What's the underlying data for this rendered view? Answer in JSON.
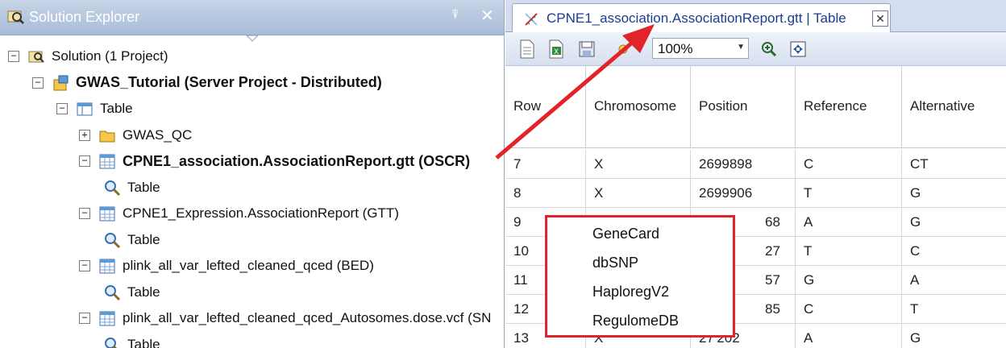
{
  "solution_explorer": {
    "title": "Solution Explorer",
    "pin_glyph": "⍒",
    "close_glyph": "✕",
    "tree": [
      {
        "label": "Solution (1 Project)",
        "expander": "−",
        "icon": "solution-icon",
        "bold": false
      },
      {
        "label": "GWAS_Tutorial (Server Project - Distributed)",
        "expander": "−",
        "icon": "project-icon",
        "bold": true
      },
      {
        "label": "Table",
        "expander": "−",
        "icon": "table-folder-icon",
        "bold": false
      },
      {
        "label": "GWAS_QC",
        "expander": "+",
        "icon": "folder-icon",
        "bold": false
      },
      {
        "label": "CPNE1_association.AssociationReport.gtt (OSCR)",
        "expander": "−",
        "icon": "table-icon",
        "bold": true
      },
      {
        "label": "Table",
        "expander": "",
        "icon": "magnifier-icon",
        "bold": false
      },
      {
        "label": "CPNE1_Expression.AssociationReport (GTT)",
        "expander": "−",
        "icon": "table-icon",
        "bold": false
      },
      {
        "label": "Table",
        "expander": "",
        "icon": "magnifier-icon",
        "bold": false
      },
      {
        "label": "plink_all_var_lefted_cleaned_qced (BED)",
        "expander": "−",
        "icon": "table-icon",
        "bold": false
      },
      {
        "label": "Table",
        "expander": "",
        "icon": "magnifier-icon",
        "bold": false
      },
      {
        "label": "plink_all_var_lefted_cleaned_qced_Autosomes.dose.vcf (SN",
        "expander": "−",
        "icon": "table-icon",
        "bold": false
      },
      {
        "label": "Table",
        "expander": "",
        "icon": "magnifier-icon",
        "bold": false
      }
    ]
  },
  "document": {
    "tab_title": "CPNE1_association.AssociationReport.gtt | Table",
    "tab_close_glyph": "✕",
    "zoom": "100%",
    "zoom_arrow": "▼",
    "columns": [
      "Row",
      "Chromosome",
      "Position",
      "Reference",
      "Alternative"
    ],
    "rows": [
      [
        "7",
        "X",
        "2699898",
        "C",
        "CT"
      ],
      [
        "8",
        "X",
        "2699906",
        "T",
        "G"
      ],
      [
        "9",
        "",
        "68",
        "A",
        "G"
      ],
      [
        "10",
        "",
        "27",
        "T",
        "C"
      ],
      [
        "11",
        "",
        "57",
        "G",
        "A"
      ],
      [
        "12",
        "",
        "85",
        "C",
        "T"
      ],
      [
        "13",
        "X",
        "27 202",
        "A",
        "G"
      ]
    ]
  },
  "context_menu": {
    "items": [
      "GeneCard",
      "dbSNP",
      "HaploregV2",
      "RegulomeDB"
    ]
  },
  "colors": {
    "highlight_red": "#e0242a",
    "titlebar_blue": "#b8c9e2",
    "tab_text_blue": "#1a3d8f"
  }
}
